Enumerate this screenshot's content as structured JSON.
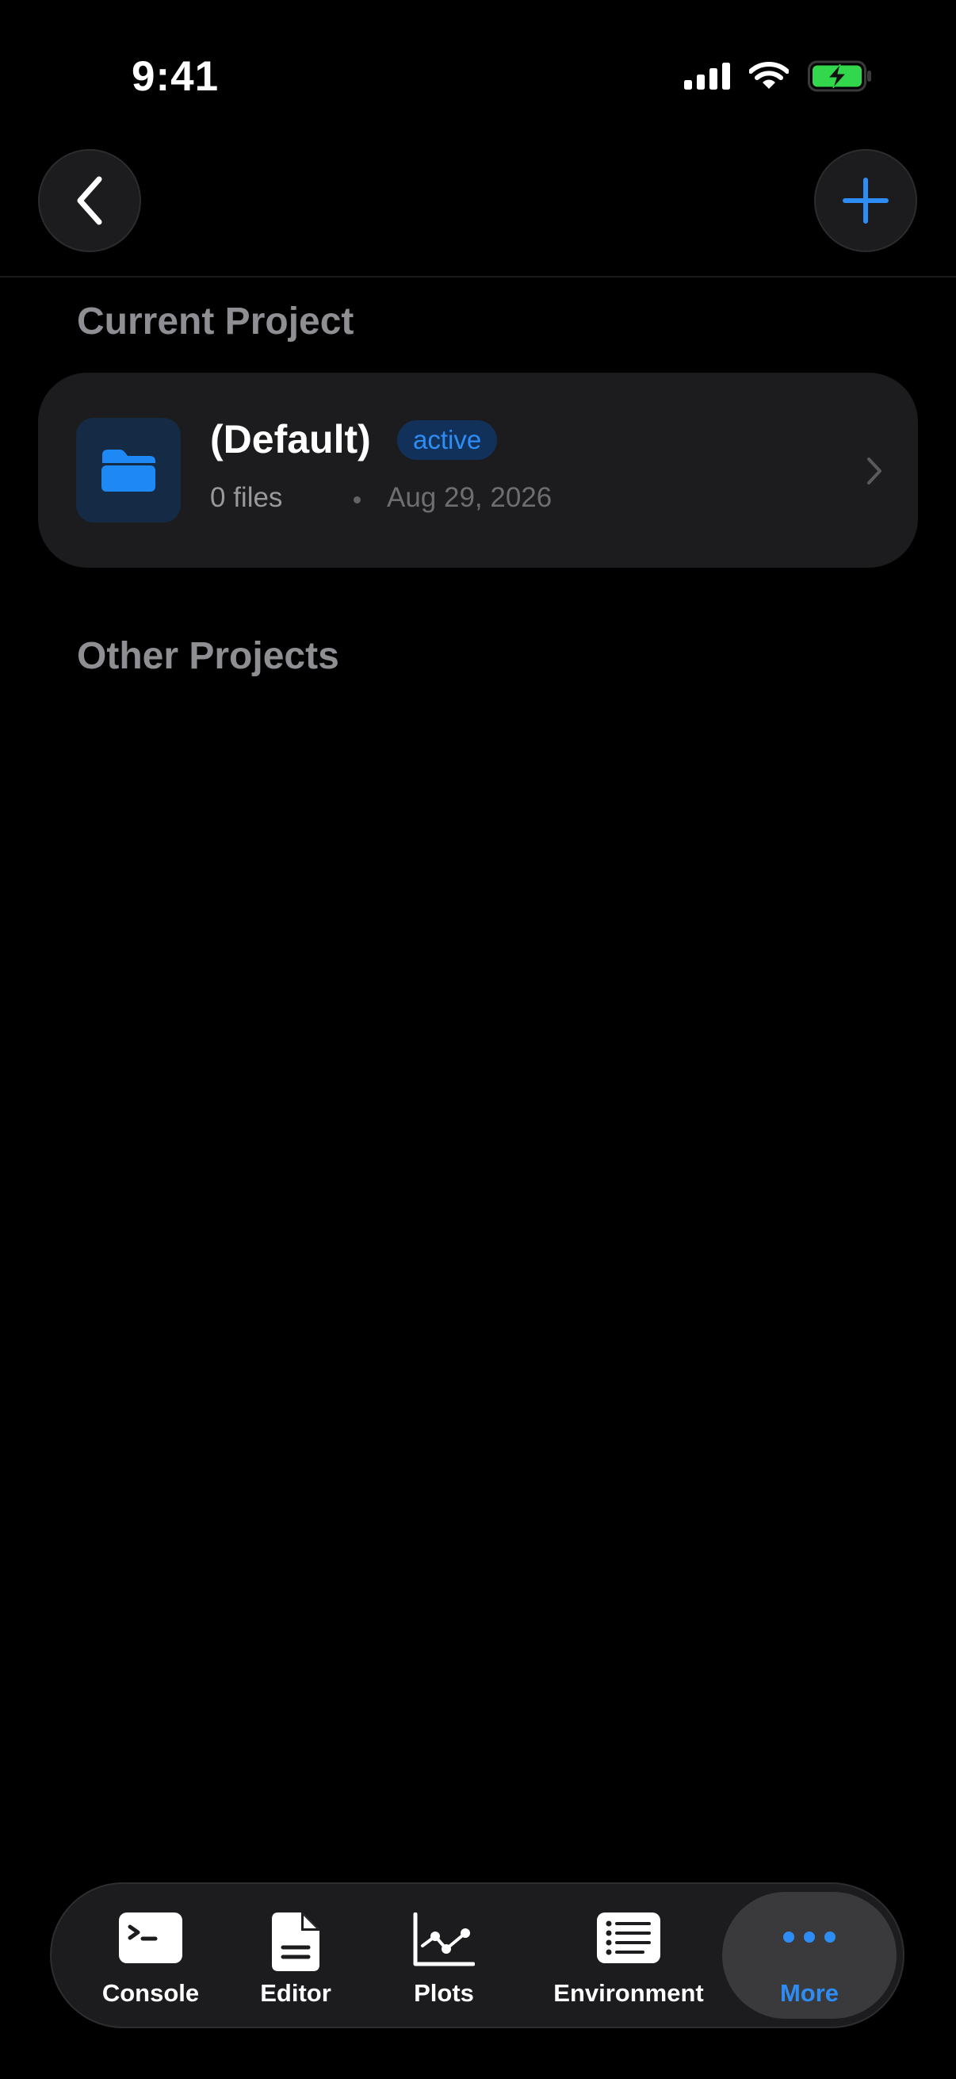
{
  "status_bar": {
    "time": "9:41"
  },
  "nav": {
    "back_icon": "chevron-left-icon",
    "add_icon": "plus-icon"
  },
  "colors": {
    "accent": "#2e8df5",
    "background": "#000000",
    "card": "#1c1c1e",
    "section_title": "#8e8e93"
  },
  "current_project": {
    "section_title": "Current Project",
    "name": "(Default)",
    "badge": "active",
    "files": "0 files",
    "date": "Aug 29, 2026",
    "icon": "folder-icon"
  },
  "other_projects": {
    "section_title": "Other Projects"
  },
  "tab_bar": {
    "selected": "More",
    "tabs": [
      {
        "label": "Console",
        "icon": "terminal-icon"
      },
      {
        "label": "Editor",
        "icon": "document-icon"
      },
      {
        "label": "Plots",
        "icon": "line-chart-icon"
      },
      {
        "label": "Environment",
        "icon": "list-icon"
      },
      {
        "label": "More",
        "icon": "ellipsis-icon"
      }
    ]
  }
}
